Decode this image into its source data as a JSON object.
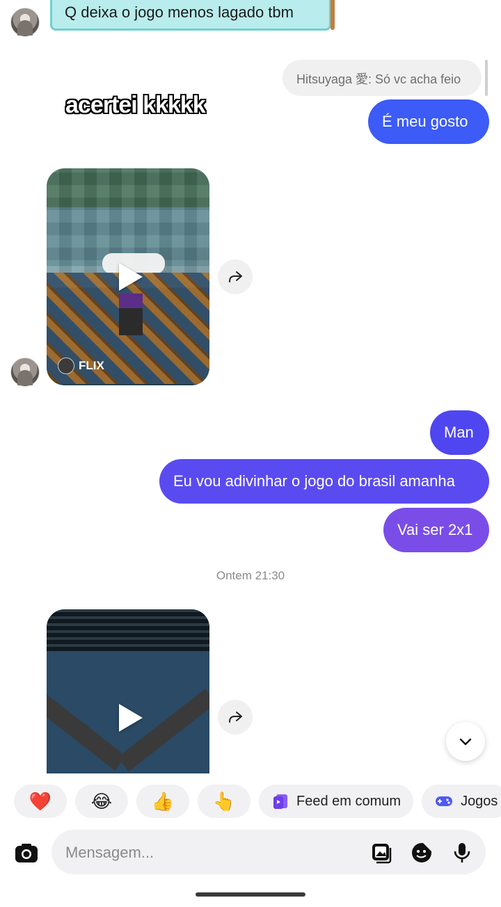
{
  "messages": {
    "received_sticker_text": "Q deixa o jogo menos lagado tbm",
    "reply_quote": "Hitsuyaga 愛: Só vc acha feio",
    "overlay_caption": "acertei kkkkk",
    "sent_1": "É meu gosto",
    "media_1_source": "FLIX",
    "sent_2": "Man",
    "sent_3": "Eu vou adivinhar o jogo do brasil amanha",
    "sent_4": "Vai ser 2x1",
    "timestamp": "Ontem 21:30"
  },
  "quick_actions": {
    "emoji_1": "❤️",
    "emoji_2": "😂",
    "emoji_3": "👍",
    "emoji_4": "👆",
    "feed_label": "Feed em comum",
    "games_label": "Jogos"
  },
  "composer": {
    "placeholder": "Mensagem..."
  },
  "colors": {
    "bubble_blue": "#3c5bf7",
    "bubble_indigo": "#4f46f0",
    "bubble_purple": "#6a4ff0",
    "bubble_violet": "#7a4de8"
  },
  "icons": {
    "camera": "camera-icon",
    "gallery": "gallery-icon",
    "sticker": "sticker-icon",
    "mic": "mic-icon",
    "share": "share-icon",
    "play": "play-icon",
    "chevron": "chevron-down-icon"
  }
}
